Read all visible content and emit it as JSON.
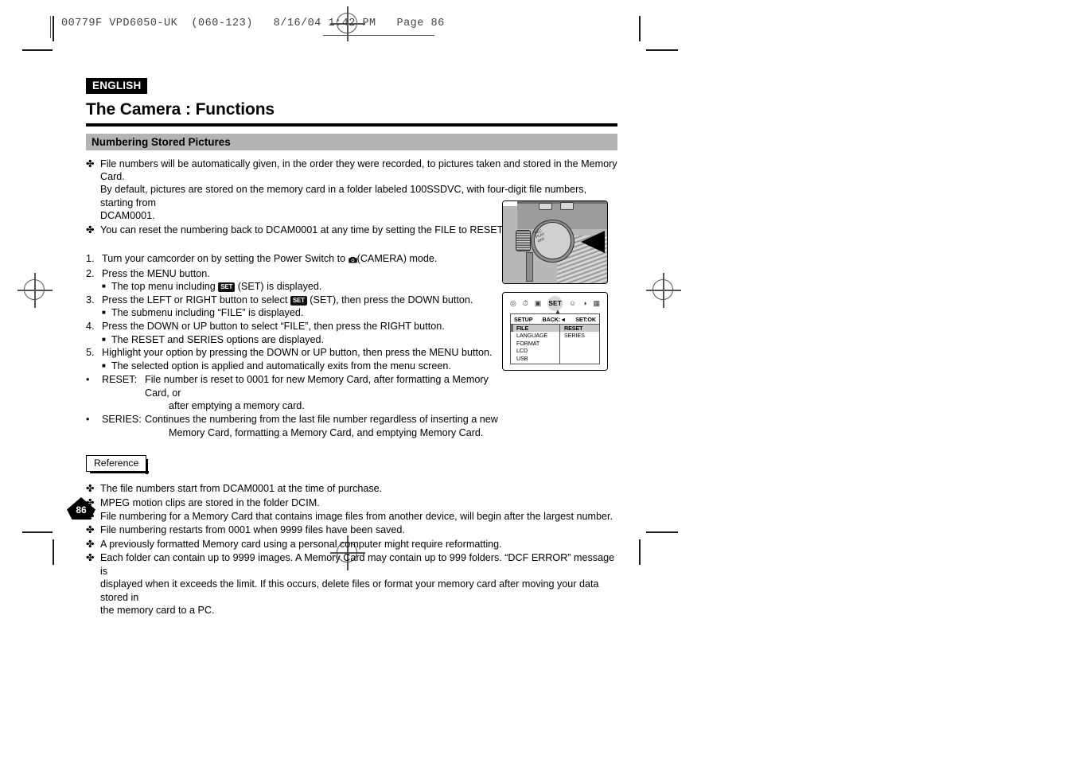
{
  "prepress": {
    "header_text": "00779F VPD6050-UK  (060-123)   8/16/04 1:42 PM   Page 86"
  },
  "document": {
    "language_badge": "ENGLISH",
    "title": "The Camera : Functions",
    "section_heading": "Numbering Stored Pictures",
    "page_number": "86"
  },
  "intro_bullets": [
    {
      "glyph": "✤",
      "lines": [
        "File numbers will be automatically given, in the order they were recorded, to pictures taken and stored in the Memory Card.",
        "By default, pictures are stored on the memory card in a folder labeled 100SSDVC, with four-digit file numbers, starting from",
        "DCAM0001."
      ]
    },
    {
      "glyph": "✤",
      "lines": [
        "You can reset the numbering back to DCAM0001 at any time by setting the FILE to RESET."
      ]
    }
  ],
  "steps": [
    {
      "number": "1.",
      "text_before": "Turn your camcorder on by setting the Power Switch to ",
      "icon": "camera-icon",
      "text_after": "(CAMERA) mode."
    },
    {
      "number": "2.",
      "text_before": "Press the MENU button.",
      "icon": "",
      "text_after": ""
    },
    {
      "number": "3.",
      "text_before": "Press the LEFT or RIGHT button to select ",
      "icon": "SET",
      "text_after": " (SET), then press the DOWN button."
    },
    {
      "number": "4.",
      "text_before": "Press the DOWN or UP button to select “FILE”, then press the RIGHT button.",
      "icon": "",
      "text_after": ""
    },
    {
      "number": "5.",
      "text_before": "Highlight your option by pressing the DOWN or UP button, then press the MENU button.",
      "icon": "",
      "text_after": ""
    }
  ],
  "sub_notes": {
    "after_step2_before": "The top menu including ",
    "after_step2_icon": "SET",
    "after_step2_after": " (SET) is displayed.",
    "after_step3": "The submenu including “FILE” is displayed.",
    "after_step4": "The RESET and SERIES options are displayed.",
    "after_step5": "The selected option is applied and automatically exits from the menu screen."
  },
  "definitions": [
    {
      "dot": "•",
      "label": "RESET:",
      "line1": "File number is reset to 0001 for new Memory Card, after formatting a Memory Card, or",
      "line2": "after emptying a memory card."
    },
    {
      "dot": "•",
      "label": "SERIES:",
      "line1": "Continues the numbering from the last file number regardless of inserting a new",
      "line2": "Memory Card, formatting a Memory Card, and emptying Memory Card."
    }
  ],
  "reference": {
    "label": "Reference",
    "glyph": "✤",
    "items": [
      [
        "The file numbers start from DCAM0001 at the time of purchase."
      ],
      [
        "MPEG motion clips are stored in the folder DCIM."
      ],
      [
        "File numbering for a Memory Card that contains image files from another device, will begin after the largest number."
      ],
      [
        "File numbering restarts from 0001 when 9999 files have been saved."
      ],
      [
        "A previously formatted Memory card using a personal computer might require reformatting."
      ],
      [
        "Each folder can contain up to 9999 images. A Memory Card may contain up to 999 folders. “DCF ERROR” message is",
        "displayed when it exceeds the limit. If this occurs, delete files or format your memory card after moving your data stored in",
        "the memory card to a PC."
      ]
    ]
  },
  "figures": {
    "camera_photo": {
      "name": "camcorder-power-switch-photo",
      "dial_labels": [
        "REC",
        "PLAY",
        "OFF"
      ]
    },
    "osd_menu": {
      "icons": [
        "no-entry-icon",
        "self-timer-icon",
        "playback-icon",
        "SET",
        "user-icon",
        "light-icon",
        "grid-icon"
      ],
      "selected_icon": "SET",
      "header": {
        "title": "SETUP",
        "back": "BACK:◄",
        "set": "SET:OK"
      },
      "left_items": [
        "FILE",
        "LANGUAGE",
        "FORMAT",
        "LCD",
        "USB"
      ],
      "left_selected": "FILE",
      "right_items": [
        "RESET",
        "SERIES"
      ],
      "right_selected": "RESET"
    }
  },
  "colors": {
    "section_bar": "#b3b3b3",
    "badge_bg": "#000000",
    "menu_highlight": "#c9c9c9"
  }
}
